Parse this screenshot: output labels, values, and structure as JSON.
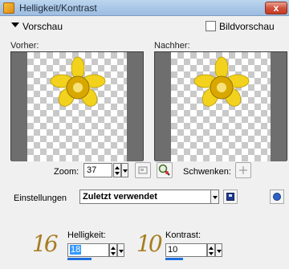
{
  "window": {
    "title": "Helligkeit/Kontrast",
    "close_symbol": "x"
  },
  "preview_section": {
    "header": "Vorschau",
    "bildvorschau_label": "Bildvorschau",
    "before_label": "Vorher:",
    "after_label": "Nachher:"
  },
  "zoom": {
    "label": "Zoom:",
    "value": "37"
  },
  "pan": {
    "label": "Schwenken:"
  },
  "settings": {
    "label": "Einstellungen",
    "value": "Zuletzt verwendet"
  },
  "params": {
    "brightness": {
      "label": "Helligkeit:",
      "value": "18",
      "annotation": "16"
    },
    "contrast": {
      "label": "Kontrast:",
      "value": "10",
      "annotation": "10"
    }
  },
  "colors": {
    "flower_petal": "#f2d21c",
    "flower_center": "#d9a800",
    "titlebar": "#a9c6e6"
  }
}
